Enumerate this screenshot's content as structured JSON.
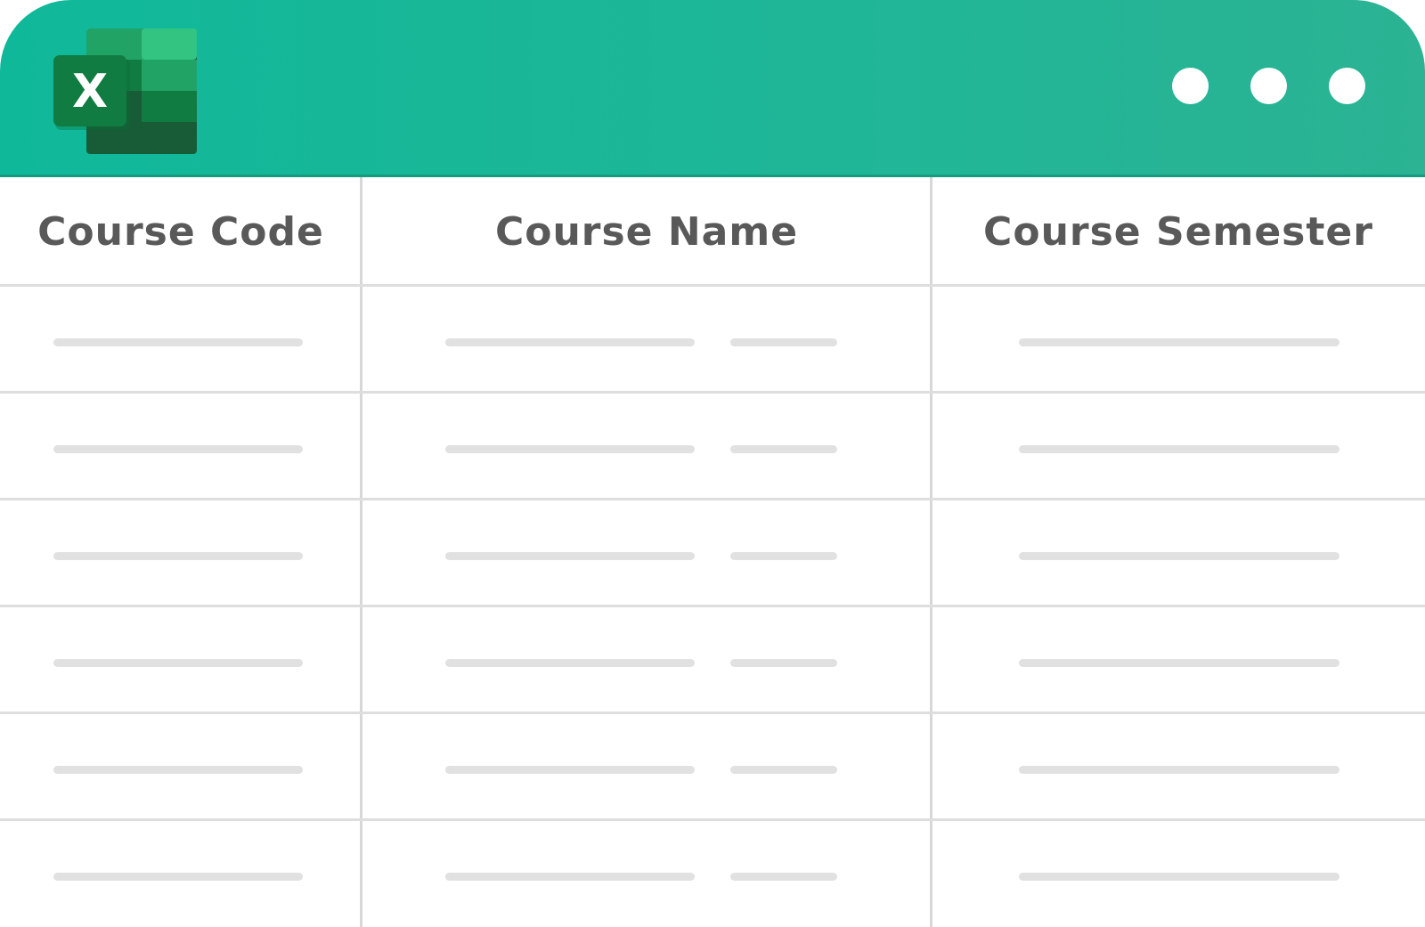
{
  "app": {
    "name": "Excel",
    "logo_letter": "X",
    "window_controls": [
      "more-dot",
      "more-dot",
      "more-dot"
    ]
  },
  "table": {
    "columns": [
      {
        "label": "Course Code"
      },
      {
        "label": "Course Name"
      },
      {
        "label": "Course Semester"
      }
    ],
    "row_count": 6
  },
  "colors": {
    "titlebar": "#12b89a",
    "header_text": "#595959",
    "placeholder_bar": "#e1e1e1",
    "grid_line": "#d7d7d7"
  }
}
